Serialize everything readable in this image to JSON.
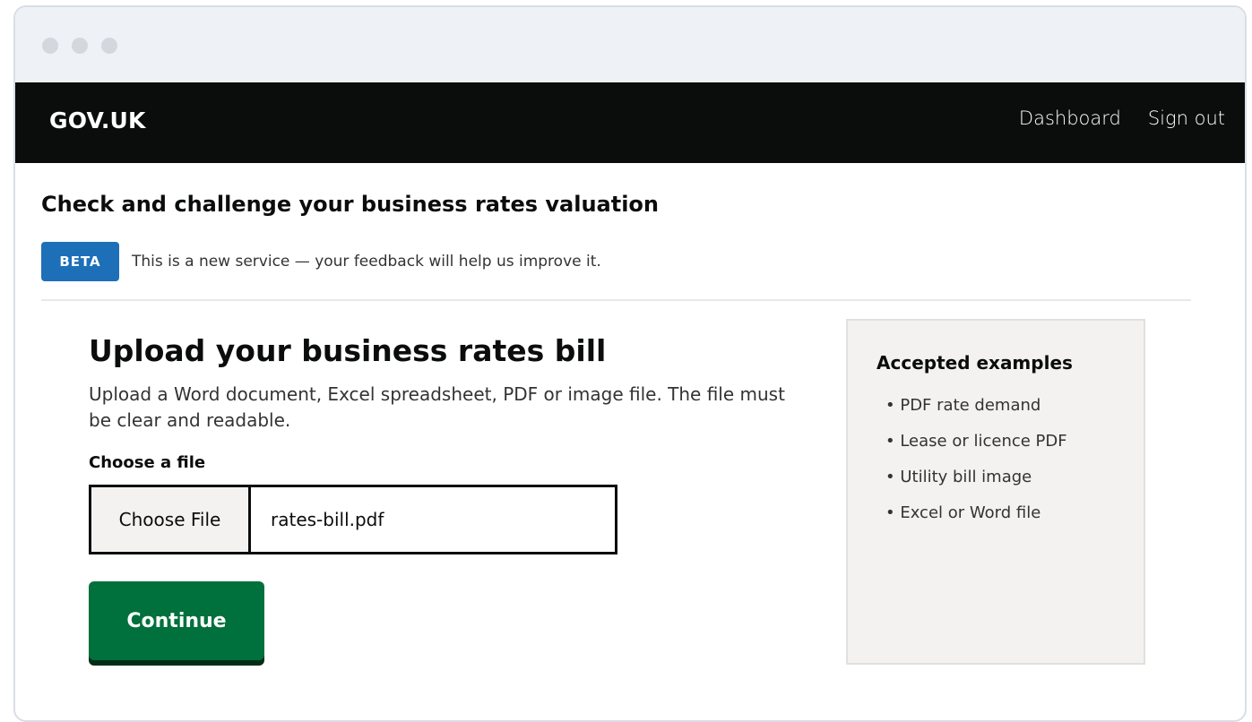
{
  "header": {
    "brand": "GOV.UK",
    "nav": [
      "Dashboard",
      "Sign out"
    ]
  },
  "service": {
    "title": "Check and challenge your business rates valuation",
    "beta_tag": "BETA",
    "beta_text": "This is a new service — your feedback will help us improve it."
  },
  "main": {
    "heading": "Upload your business rates bill",
    "lead": "Upload a Word document, Excel spreadsheet, PDF or image file. The file must be clear and readable.",
    "field_label": "Choose a file",
    "choose_button": "Choose File",
    "file_name": "rates-bill.pdf",
    "continue_label": "Continue"
  },
  "aside": {
    "title": "Accepted examples",
    "items": [
      "PDF rate demand",
      "Lease or licence PDF",
      "Utility bill image",
      "Excel or Word file"
    ]
  },
  "colors": {
    "header_bg": "#0b0c0c",
    "beta_blue": "#1d70b8",
    "button_green": "#00703c",
    "aside_bg": "#f3f2f1"
  }
}
